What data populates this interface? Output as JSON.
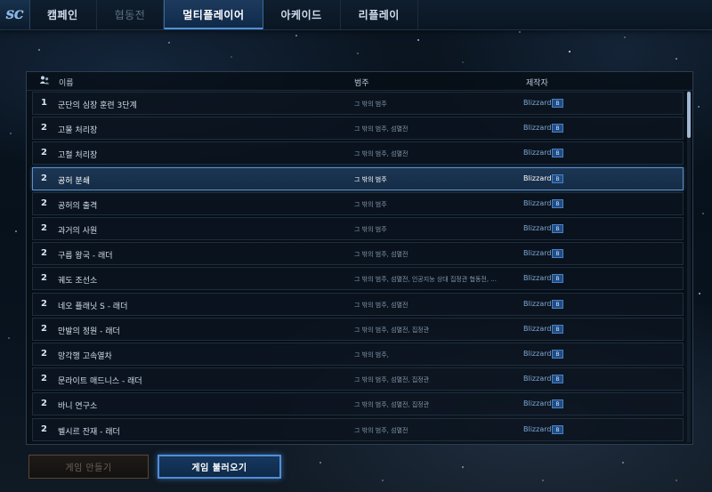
{
  "nav": {
    "logo_text": "SC",
    "tabs": [
      {
        "label": "캠페인",
        "state": "normal"
      },
      {
        "label": "협동전",
        "state": "disabled"
      },
      {
        "label": "멀티플레이어",
        "state": "active"
      },
      {
        "label": "아케이드",
        "state": "normal"
      },
      {
        "label": "리플레이",
        "state": "normal"
      }
    ]
  },
  "table": {
    "columns": {
      "name": "이름",
      "category": "범주",
      "author": "제작자"
    },
    "header_icon": "players-icon",
    "rows": [
      {
        "num": "1",
        "name": "군단의 심장 훈련 3단계",
        "category": "그 밖의 범주",
        "author": "Blizzard"
      },
      {
        "num": "2",
        "name": "고물 처리장",
        "category": "그 밖의 범주, 섬멸전",
        "author": "Blizzard"
      },
      {
        "num": "2",
        "name": "고철 처리장",
        "category": "그 밖의 범주, 섬멸전",
        "author": "Blizzard"
      },
      {
        "num": "2",
        "name": "공허 분쇄",
        "category": "그 밖의 범주",
        "author": "Blizzard"
      },
      {
        "num": "2",
        "name": "공허의 출격",
        "category": "그 밖의 범주",
        "author": "Blizzard"
      },
      {
        "num": "2",
        "name": "과거의 사원",
        "category": "그 밖의 범주",
        "author": "Blizzard"
      },
      {
        "num": "2",
        "name": "구름 왕국 - 래더",
        "category": "그 밖의 범주, 섬멸전",
        "author": "Blizzard"
      },
      {
        "num": "2",
        "name": "궤도 조선소",
        "category": "그 밖의 범주, 섬멸전, 인공지능 상대 집정관 협동전, ...",
        "author": "Blizzard"
      },
      {
        "num": "2",
        "name": "네오 플래닛 S - 래더",
        "category": "그 밖의 범주, 섬멸전",
        "author": "Blizzard"
      },
      {
        "num": "2",
        "name": "만발의 정원 - 래더",
        "category": "그 밖의 범주, 섬멸전, 집정관",
        "author": "Blizzard"
      },
      {
        "num": "2",
        "name": "망각행 고속열차",
        "category": "그 밖의 범주, ",
        "author": "Blizzard"
      },
      {
        "num": "2",
        "name": "문라이트 매드니스 - 래더",
        "category": "그 밖의 범주, 섬멸전, 집정관",
        "author": "Blizzard"
      },
      {
        "num": "2",
        "name": "바니 연구소",
        "category": "그 밖의 범주, 섬멸전, 집정관",
        "author": "Blizzard"
      },
      {
        "num": "2",
        "name": "벨시르 잔재 - 래더",
        "category": "그 밖의 범주, 섬멸전",
        "author": "Blizzard"
      }
    ],
    "selected_index": 3,
    "badge_icon": "blizzard-badge-icon",
    "badge_text": "B"
  },
  "buttons": {
    "create_game": "게임 만들기",
    "load_game": "게임 불러오기"
  }
}
